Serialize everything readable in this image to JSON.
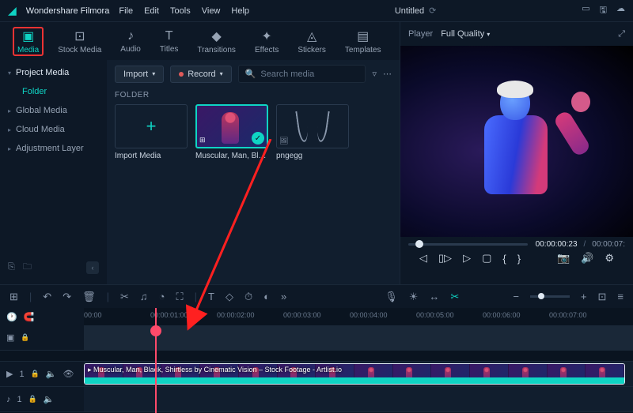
{
  "titlebar": {
    "appname": "Wondershare Filmora",
    "menus": [
      "File",
      "Edit",
      "Tools",
      "View",
      "Help"
    ],
    "document": "Untitled"
  },
  "nav": [
    {
      "id": "media",
      "label": "Media",
      "icon": "▣",
      "active": true
    },
    {
      "id": "stock",
      "label": "Stock Media",
      "icon": "⊡"
    },
    {
      "id": "audio",
      "label": "Audio",
      "icon": "♪"
    },
    {
      "id": "titles",
      "label": "Titles",
      "icon": "T"
    },
    {
      "id": "transitions",
      "label": "Transitions",
      "icon": "◆"
    },
    {
      "id": "effects",
      "label": "Effects",
      "icon": "✦"
    },
    {
      "id": "stickers",
      "label": "Stickers",
      "icon": "◬"
    },
    {
      "id": "templates",
      "label": "Templates",
      "icon": "▤"
    }
  ],
  "sidebar": {
    "items": [
      {
        "id": "project",
        "label": "Project Media",
        "kind": "project"
      },
      {
        "id": "folder",
        "label": "Folder",
        "kind": "folder"
      },
      {
        "id": "global",
        "label": "Global Media",
        "kind": "item"
      },
      {
        "id": "cloud",
        "label": "Cloud Media",
        "kind": "item"
      },
      {
        "id": "adjust",
        "label": "Adjustment Layer",
        "kind": "item"
      }
    ]
  },
  "controls": {
    "import": "Import",
    "record": "Record",
    "search_placeholder": "Search media"
  },
  "folderHeader": "FOLDER",
  "cards": [
    {
      "id": "import",
      "type": "import",
      "label": "Import Media"
    },
    {
      "id": "clip1",
      "type": "video",
      "label": "Muscular, Man, Black,...",
      "selected": true
    },
    {
      "id": "png1",
      "type": "image",
      "label": "pngegg"
    }
  ],
  "player": {
    "label": "Player",
    "quality": "Full Quality",
    "current": "00:00:00:23",
    "duration": "00:00:07:"
  },
  "timeline": {
    "marks": [
      "00:00",
      "00:00:01:00",
      "00:00:02:00",
      "00:00:03:00",
      "00:00:04:00",
      "00:00:05:00",
      "00:00:06:00",
      "00:00:07:00"
    ],
    "clipName": "Muscular, Man, Black, Shirtless by Cinematic Vision – Stock Footage - Artlist.io",
    "videoTrack": "1",
    "audioTrack": "1"
  }
}
